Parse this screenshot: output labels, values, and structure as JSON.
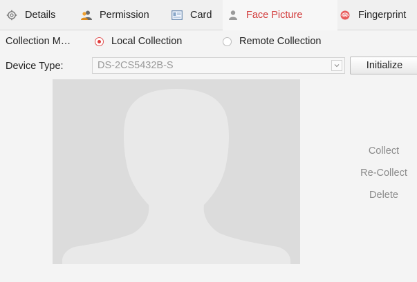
{
  "tabs": [
    {
      "label": "Details",
      "icon": "settings-icon"
    },
    {
      "label": "Permission",
      "icon": "user-group-icon"
    },
    {
      "label": "Card",
      "icon": "card-icon"
    },
    {
      "label": "Face Picture",
      "icon": "person-icon",
      "active": true
    },
    {
      "label": "Fingerprint",
      "icon": "fingerprint-icon"
    }
  ],
  "collection": {
    "label": "Collection M…",
    "options": [
      {
        "label": "Local Collection",
        "selected": true
      },
      {
        "label": "Remote Collection",
        "selected": false
      }
    ]
  },
  "device": {
    "label": "Device Type:",
    "value": "DS-2CS5432B-S",
    "initialize_label": "Initialize"
  },
  "actions": {
    "collect": "Collect",
    "recollect": "Re-Collect",
    "delete": "Delete"
  },
  "colors": {
    "accent": "#d23a3a",
    "placeholder_bg": "#dcdcdc",
    "placeholder_fg": "#e9e9e9"
  }
}
